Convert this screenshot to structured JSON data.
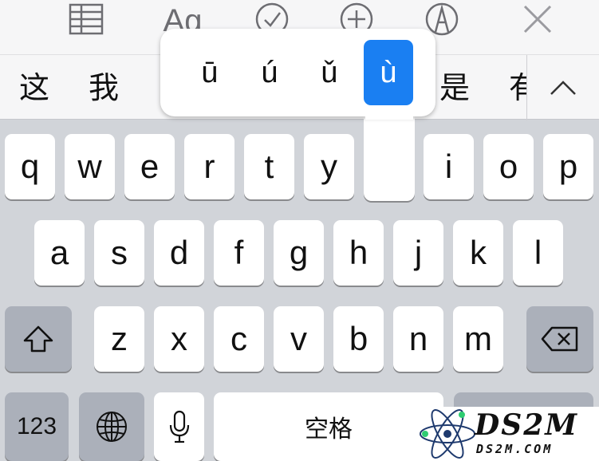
{
  "toolbar": {
    "items": [
      {
        "name": "table-icon"
      },
      {
        "name": "text-format-icon",
        "label": "Ag"
      },
      {
        "name": "checkmark-circle-icon"
      },
      {
        "name": "add-circle-icon"
      },
      {
        "name": "pen-icon"
      },
      {
        "name": "close-icon"
      }
    ]
  },
  "candidates": {
    "items": [
      "这",
      "我",
      "是",
      "有"
    ],
    "collapse_icon": "chevron-up-icon"
  },
  "accent_popup": {
    "variants": [
      "ū",
      "ú",
      "ǔ",
      "ù"
    ],
    "selected_index": 3,
    "selected_color": "#1a7ff2"
  },
  "keyboard": {
    "row1": [
      "q",
      "w",
      "e",
      "r",
      "t",
      "y",
      "i",
      "o",
      "p"
    ],
    "row2": [
      "a",
      "s",
      "d",
      "f",
      "g",
      "h",
      "j",
      "k",
      "l"
    ],
    "row3": [
      "z",
      "x",
      "c",
      "v",
      "b",
      "n",
      "m"
    ],
    "shift_icon": "shift-icon",
    "delete_icon": "delete-icon",
    "numbers_label": "123",
    "globe_icon": "globe-icon",
    "mic_icon": "microphone-icon",
    "space_label": "空格"
  },
  "watermark": {
    "title": "DS2M",
    "url": "DS2M.COM"
  }
}
